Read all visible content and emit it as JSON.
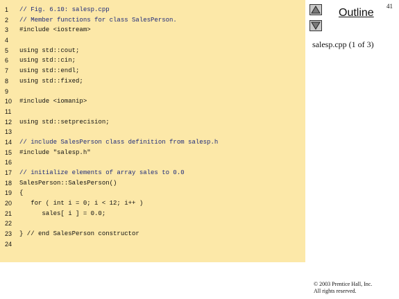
{
  "slide_number": "41",
  "outline_label": "Outline",
  "file_label": "salesp.cpp (1 of 3)",
  "copyright": [
    "© 2003 Prentice Hall, Inc.",
    "All rights reserved."
  ],
  "nav": {
    "up_icon": "triangle-up-icon",
    "down_icon": "triangle-down-icon"
  },
  "code_lines": [
    {
      "n": "1",
      "text": "// Fig. 6.10: salesp.cpp",
      "kind": "comment"
    },
    {
      "n": "2",
      "text": "// Member functions for class SalesPerson.",
      "kind": "comment"
    },
    {
      "n": "3",
      "text": "#include <iostream>",
      "kind": "keyword"
    },
    {
      "n": "4",
      "text": "",
      "kind": "normal"
    },
    {
      "n": "5",
      "text": "using std::cout;",
      "kind": "keyword"
    },
    {
      "n": "6",
      "text": "using std::cin;",
      "kind": "keyword"
    },
    {
      "n": "7",
      "text": "using std::endl;",
      "kind": "keyword"
    },
    {
      "n": "8",
      "text": "using std::fixed;",
      "kind": "keyword"
    },
    {
      "n": "9",
      "text": "",
      "kind": "normal"
    },
    {
      "n": "10",
      "text": "#include <iomanip>",
      "kind": "keyword"
    },
    {
      "n": "11",
      "text": "",
      "kind": "normal"
    },
    {
      "n": "12",
      "text": "using std::setprecision;",
      "kind": "keyword"
    },
    {
      "n": "13",
      "text": "",
      "kind": "normal"
    },
    {
      "n": "14",
      "text": "// include SalesPerson class definition from salesp.h",
      "kind": "comment"
    },
    {
      "n": "15",
      "text": "#include \"salesp.h\"",
      "kind": "keyword"
    },
    {
      "n": "16",
      "text": "",
      "kind": "normal"
    },
    {
      "n": "17",
      "text": "// initialize elements of array sales to 0.0",
      "kind": "comment"
    },
    {
      "n": "18",
      "text": "SalesPerson::SalesPerson()",
      "kind": "normal"
    },
    {
      "n": "19",
      "text": "{",
      "kind": "normal"
    },
    {
      "n": "20",
      "text": "   for ( int i = 0; i < 12; i++ )",
      "kind": "normal"
    },
    {
      "n": "21",
      "text": "      sales[ i ] = 0.0;",
      "kind": "normal"
    },
    {
      "n": "22",
      "text": "",
      "kind": "normal"
    },
    {
      "n": "23",
      "text": "} // end SalesPerson constructor",
      "kind": "normal"
    },
    {
      "n": "24",
      "text": "",
      "kind": "normal"
    }
  ]
}
